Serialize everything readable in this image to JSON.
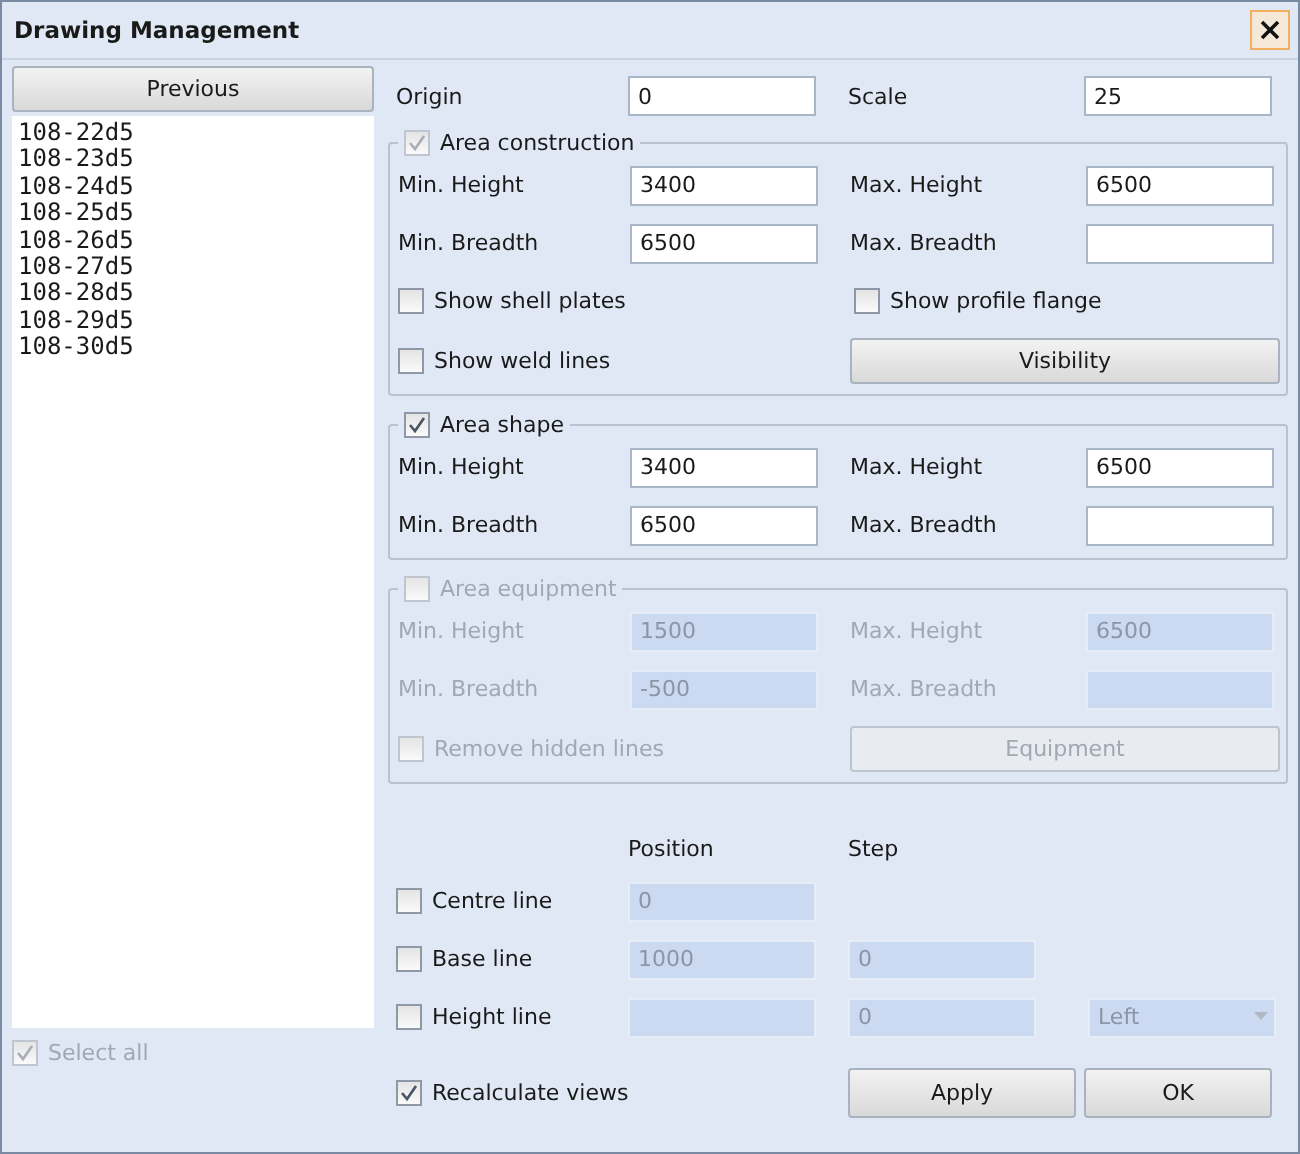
{
  "window": {
    "title": "Drawing Management"
  },
  "previous_button": "Previous",
  "drawings": [
    {
      "name": "108-22d5"
    },
    {
      "name": "108-23d5"
    },
    {
      "name": "108-24d5"
    },
    {
      "name": "108-25d5"
    },
    {
      "name": "108-26d5"
    },
    {
      "name": "108-27d5"
    },
    {
      "name": "108-28d5"
    },
    {
      "name": "108-29d5"
    },
    {
      "name": "108-30d5"
    }
  ],
  "select_all": {
    "label": "Select all",
    "checked": true,
    "disabled": true
  },
  "origin": {
    "label": "Origin",
    "value": "0"
  },
  "scale": {
    "label": "Scale",
    "value": "25"
  },
  "groups": [
    {
      "title": "Area construction",
      "checked": true,
      "disabled": false,
      "check_disabled": true,
      "fields": [
        {
          "label": "Min. Height",
          "value": "3400",
          "disabled": false
        },
        {
          "label": "Max. Height",
          "value": "6500",
          "disabled": false
        },
        {
          "label": "Min. Breadth",
          "value": "6500",
          "disabled": false
        },
        {
          "label": "Max. Breadth",
          "disabled": false
        }
      ],
      "options": [
        {
          "label": "Show shell plates",
          "checked": false,
          "disabled": false
        },
        {
          "label": "Show profile flange",
          "checked": false,
          "disabled": false
        },
        {
          "label": "Show weld lines",
          "checked": false,
          "disabled": false
        }
      ],
      "button": {
        "label": "Visibility",
        "disabled": false
      }
    },
    {
      "title": "Area shape",
      "checked": true,
      "disabled": false,
      "check_disabled": false,
      "fields": [
        {
          "label": "Min. Height",
          "value": "3400",
          "disabled": false
        },
        {
          "label": "Max. Height",
          "value": "6500",
          "disabled": false
        },
        {
          "label": "Min. Breadth",
          "value": "6500",
          "disabled": false
        },
        {
          "label": "Max. Breadth",
          "disabled": false
        }
      ]
    },
    {
      "title": "Area equipment",
      "checked": false,
      "disabled": true,
      "check_disabled": true,
      "fields": [
        {
          "label": "Min. Height",
          "value": "1500",
          "disabled": true
        },
        {
          "label": "Max. Height",
          "value": "6500",
          "disabled": true
        },
        {
          "label": "Min. Breadth",
          "value": "-500",
          "disabled": true
        },
        {
          "label": "Max. Breadth",
          "disabled": true
        }
      ],
      "options": [
        {
          "label": "Remove hidden lines",
          "checked": false,
          "disabled": true
        }
      ],
      "button": {
        "label": "Equipment",
        "disabled": true
      }
    }
  ],
  "line_headers": [
    "Position",
    "Step"
  ],
  "lines": [
    {
      "label": "Centre line",
      "checked": false,
      "position": {
        "value": "0",
        "disabled": true
      }
    },
    {
      "label": "Base line",
      "checked": false,
      "position": {
        "value": "1000",
        "disabled": true
      },
      "step": {
        "value": "0",
        "disabled": true
      }
    },
    {
      "label": "Height line",
      "checked": false,
      "position": {
        "disabled": true
      },
      "step": {
        "value": "0",
        "disabled": true
      },
      "align": {
        "value": "Left",
        "disabled": true
      }
    }
  ],
  "recalculate": {
    "label": "Recalculate views",
    "checked": true
  },
  "buttons": [
    {
      "label": "Apply"
    },
    {
      "label": "OK"
    }
  ]
}
